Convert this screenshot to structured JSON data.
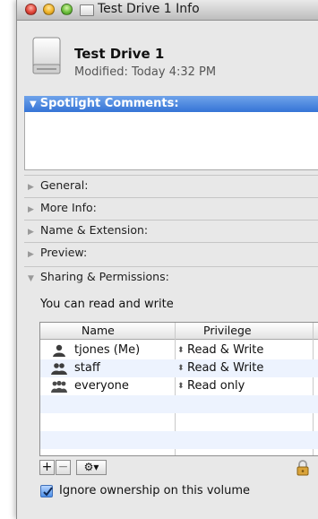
{
  "window": {
    "title": "Test Drive 1 Info"
  },
  "header": {
    "name": "Test Drive 1",
    "modified": "Modified: Today 4:32 PM"
  },
  "spotlight": {
    "label": "Spotlight Comments:",
    "value": ""
  },
  "sections": {
    "general": "General:",
    "more_info": "More Info:",
    "name_extension": "Name & Extension:",
    "preview": "Preview:",
    "sharing": "Sharing & Permissions:"
  },
  "sharing": {
    "status": "You can read and write",
    "columns": {
      "name": "Name",
      "privilege": "Privilege"
    },
    "rows": [
      {
        "name": "tjones (Me)",
        "privilege": "Read & Write",
        "icon": "single-user-icon"
      },
      {
        "name": "staff",
        "privilege": "Read & Write",
        "icon": "group-icon"
      },
      {
        "name": "everyone",
        "privilege": "Read only",
        "icon": "everyone-icon"
      }
    ],
    "buttons": {
      "add": "+",
      "remove": "−",
      "action": "⚙▾"
    },
    "ignore_ownership": {
      "label": "Ignore ownership on this volume",
      "checked": true
    }
  },
  "colors": {
    "selection_blue": "#3574d6",
    "row_alt": "#edf3fe"
  }
}
